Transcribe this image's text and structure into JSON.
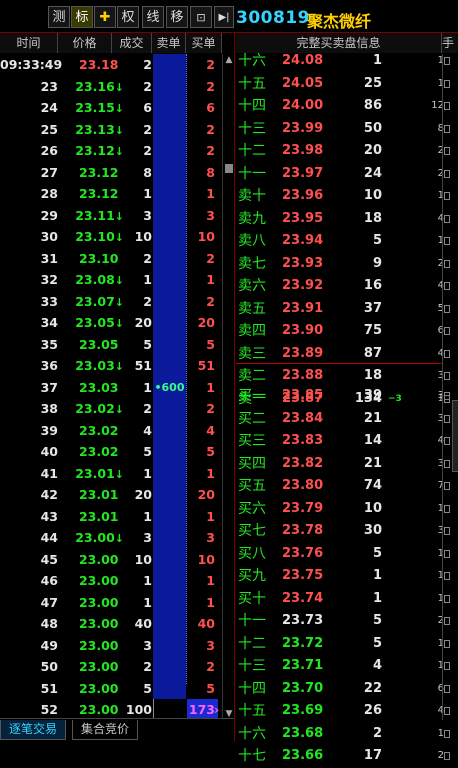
{
  "toolbar": {
    "buttons": [
      "测",
      "标",
      "✚",
      "权",
      "线",
      "移",
      "⊡",
      "▶|"
    ],
    "code": "300819",
    "name": "聚杰微纤"
  },
  "tick_headers": [
    "时间",
    "价格",
    "成交",
    "卖单",
    "买单"
  ],
  "ticks": [
    {
      "time": "09:33:49",
      "price": "23.18",
      "dir": "",
      "vol": "2",
      "sell": "",
      "buy": "2"
    },
    {
      "time": "23",
      "price": "23.16",
      "dir": "down",
      "vol": "2",
      "sell": "",
      "buy": "2"
    },
    {
      "time": "24",
      "price": "23.15",
      "dir": "down",
      "vol": "6",
      "sell": "",
      "buy": "6"
    },
    {
      "time": "25",
      "price": "23.13",
      "dir": "down",
      "vol": "2",
      "sell": "",
      "buy": "2"
    },
    {
      "time": "26",
      "price": "23.12",
      "dir": "down",
      "vol": "2",
      "sell": "",
      "buy": "2"
    },
    {
      "time": "27",
      "price": "23.12",
      "dir": "",
      "vol": "8",
      "sell": "",
      "buy": "8"
    },
    {
      "time": "28",
      "price": "23.12",
      "dir": "",
      "vol": "1",
      "sell": "",
      "buy": "1"
    },
    {
      "time": "29",
      "price": "23.11",
      "dir": "down",
      "vol": "3",
      "sell": "",
      "buy": "3"
    },
    {
      "time": "30",
      "price": "23.10",
      "dir": "down",
      "vol": "10",
      "sell": "",
      "buy": "10"
    },
    {
      "time": "31",
      "price": "23.10",
      "dir": "",
      "vol": "2",
      "sell": "",
      "buy": "2"
    },
    {
      "time": "32",
      "price": "23.08",
      "dir": "down",
      "vol": "1",
      "sell": "",
      "buy": "1"
    },
    {
      "time": "33",
      "price": "23.07",
      "dir": "down",
      "vol": "2",
      "sell": "",
      "buy": "2"
    },
    {
      "time": "34",
      "price": "23.05",
      "dir": "down",
      "vol": "20",
      "sell": "",
      "buy": "20"
    },
    {
      "time": "35",
      "price": "23.05",
      "dir": "",
      "vol": "5",
      "sell": "",
      "buy": "5"
    },
    {
      "time": "36",
      "price": "23.03",
      "dir": "down",
      "vol": "51",
      "sell": "",
      "buy": "51"
    },
    {
      "time": "37",
      "price": "23.03",
      "dir": "",
      "vol": "1",
      "sell": "600",
      "buy": "1"
    },
    {
      "time": "38",
      "price": "23.02",
      "dir": "down",
      "vol": "2",
      "sell": "",
      "buy": "2"
    },
    {
      "time": "39",
      "price": "23.02",
      "dir": "",
      "vol": "4",
      "sell": "",
      "buy": "4"
    },
    {
      "time": "40",
      "price": "23.02",
      "dir": "",
      "vol": "5",
      "sell": "",
      "buy": "5"
    },
    {
      "time": "41",
      "price": "23.01",
      "dir": "down",
      "vol": "1",
      "sell": "",
      "buy": "1"
    },
    {
      "time": "42",
      "price": "23.01",
      "dir": "",
      "vol": "20",
      "sell": "",
      "buy": "20"
    },
    {
      "time": "43",
      "price": "23.01",
      "dir": "",
      "vol": "1",
      "sell": "",
      "buy": "1"
    },
    {
      "time": "44",
      "price": "23.00",
      "dir": "down",
      "vol": "3",
      "sell": "",
      "buy": "3"
    },
    {
      "time": "45",
      "price": "23.00",
      "dir": "",
      "vol": "10",
      "sell": "",
      "buy": "10"
    },
    {
      "time": "46",
      "price": "23.00",
      "dir": "",
      "vol": "1",
      "sell": "",
      "buy": "1"
    },
    {
      "time": "47",
      "price": "23.00",
      "dir": "",
      "vol": "1",
      "sell": "",
      "buy": "1"
    },
    {
      "time": "48",
      "price": "23.00",
      "dir": "",
      "vol": "40",
      "sell": "",
      "buy": "40"
    },
    {
      "time": "49",
      "price": "23.00",
      "dir": "",
      "vol": "3",
      "sell": "",
      "buy": "3"
    },
    {
      "time": "50",
      "price": "23.00",
      "dir": "",
      "vol": "2",
      "sell": "",
      "buy": "2"
    },
    {
      "time": "51",
      "price": "23.00",
      "dir": "",
      "vol": "5",
      "sell": "",
      "buy": "5"
    },
    {
      "time": "52",
      "price": "23.00",
      "dir": "",
      "vol": "100",
      "sell": "",
      "buy": "173"
    }
  ],
  "book_header": "完整买卖盘信息",
  "book_header_right": "手",
  "asks": [
    {
      "label": "十六",
      "price": "24.08",
      "qty": "1",
      "chg": "",
      "cnt": "1"
    },
    {
      "label": "十五",
      "price": "24.05",
      "qty": "25",
      "chg": "",
      "cnt": "1"
    },
    {
      "label": "十四",
      "price": "24.00",
      "qty": "86",
      "chg": "",
      "cnt": "12"
    },
    {
      "label": "十三",
      "price": "23.99",
      "qty": "50",
      "chg": "",
      "cnt": "8"
    },
    {
      "label": "十二",
      "price": "23.98",
      "qty": "20",
      "chg": "",
      "cnt": "2"
    },
    {
      "label": "十一",
      "price": "23.97",
      "qty": "24",
      "chg": "",
      "cnt": "2"
    },
    {
      "label": "卖十",
      "price": "23.96",
      "qty": "10",
      "chg": "",
      "cnt": "1"
    },
    {
      "label": "卖九",
      "price": "23.95",
      "qty": "18",
      "chg": "",
      "cnt": "4"
    },
    {
      "label": "卖八",
      "price": "23.94",
      "qty": "5",
      "chg": "",
      "cnt": "1"
    },
    {
      "label": "卖七",
      "price": "23.93",
      "qty": "9",
      "chg": "",
      "cnt": "2"
    },
    {
      "label": "卖六",
      "price": "23.92",
      "qty": "16",
      "chg": "",
      "cnt": "4"
    },
    {
      "label": "卖五",
      "price": "23.91",
      "qty": "37",
      "chg": "",
      "cnt": "5"
    },
    {
      "label": "卖四",
      "price": "23.90",
      "qty": "75",
      "chg": "",
      "cnt": "6"
    },
    {
      "label": "卖三",
      "price": "23.89",
      "qty": "87",
      "chg": "",
      "cnt": "4"
    },
    {
      "label": "卖二",
      "price": "23.88",
      "qty": "18",
      "chg": "",
      "cnt": "3"
    },
    {
      "label": "卖一",
      "price": "23.87",
      "qty": "134",
      "chg": "−3",
      "cnt": "1"
    }
  ],
  "bids": [
    {
      "label": "买一",
      "price": "23.85",
      "qty": "39",
      "chg": "",
      "cnt": "3",
      "color": "red"
    },
    {
      "label": "买二",
      "price": "23.84",
      "qty": "21",
      "chg": "",
      "cnt": "3",
      "color": "red"
    },
    {
      "label": "买三",
      "price": "23.83",
      "qty": "14",
      "chg": "",
      "cnt": "4",
      "color": "red"
    },
    {
      "label": "买四",
      "price": "23.82",
      "qty": "21",
      "chg": "",
      "cnt": "3",
      "color": "red"
    },
    {
      "label": "买五",
      "price": "23.80",
      "qty": "74",
      "chg": "",
      "cnt": "7",
      "color": "red"
    },
    {
      "label": "买六",
      "price": "23.79",
      "qty": "10",
      "chg": "",
      "cnt": "1",
      "color": "red"
    },
    {
      "label": "买七",
      "price": "23.78",
      "qty": "30",
      "chg": "",
      "cnt": "3",
      "color": "red"
    },
    {
      "label": "买八",
      "price": "23.76",
      "qty": "5",
      "chg": "",
      "cnt": "1",
      "color": "red"
    },
    {
      "label": "买九",
      "price": "23.75",
      "qty": "1",
      "chg": "",
      "cnt": "1",
      "color": "red"
    },
    {
      "label": "买十",
      "price": "23.74",
      "qty": "1",
      "chg": "",
      "cnt": "1",
      "color": "red"
    },
    {
      "label": "十一",
      "price": "23.73",
      "qty": "5",
      "chg": "",
      "cnt": "2",
      "color": "white"
    },
    {
      "label": "十二",
      "price": "23.72",
      "qty": "5",
      "chg": "",
      "cnt": "1",
      "color": "green"
    },
    {
      "label": "十三",
      "price": "23.71",
      "qty": "4",
      "chg": "",
      "cnt": "1",
      "color": "green"
    },
    {
      "label": "十四",
      "price": "23.70",
      "qty": "22",
      "chg": "",
      "cnt": "6",
      "color": "green"
    },
    {
      "label": "十五",
      "price": "23.69",
      "qty": "26",
      "chg": "",
      "cnt": "4",
      "color": "green"
    },
    {
      "label": "十六",
      "price": "23.68",
      "qty": "2",
      "chg": "",
      "cnt": "1",
      "color": "green"
    },
    {
      "label": "十七",
      "price": "23.66",
      "qty": "17",
      "chg": "",
      "cnt": "2",
      "color": "green"
    }
  ],
  "tabs": [
    "逐笔交易",
    "集合竞价"
  ],
  "colors": {
    "up": "#ff5050",
    "down": "#22e622",
    "code": "#33d4ff",
    "name": "#ffd000",
    "sell_bg": "#0a1a9a"
  }
}
